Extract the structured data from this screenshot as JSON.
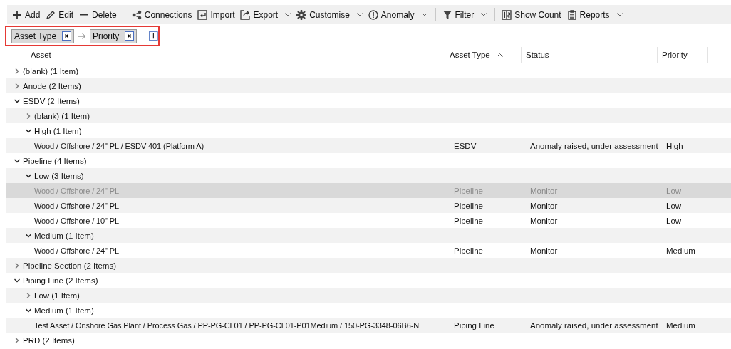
{
  "toolbar": {
    "groups": [
      [
        {
          "label": "Add",
          "has_menu": false
        },
        {
          "label": "Edit",
          "has_menu": false
        },
        {
          "label": "Delete",
          "has_menu": false
        }
      ],
      [
        {
          "label": "Connections",
          "has_menu": false
        },
        {
          "label": "Import",
          "has_menu": false
        },
        {
          "label": "Export",
          "has_menu": true
        },
        {
          "label": "Customise",
          "has_menu": true
        },
        {
          "label": "Anomaly",
          "has_menu": true
        }
      ],
      [
        {
          "label": "Filter",
          "has_menu": true
        }
      ],
      [
        {
          "label": "Show Count",
          "has_menu": false
        },
        {
          "label": "Reports",
          "has_menu": true
        }
      ]
    ]
  },
  "group_by": {
    "chips": [
      {
        "label": "Asset Type"
      },
      {
        "label": "Priority"
      }
    ]
  },
  "table": {
    "columns": [
      {
        "label": "Asset"
      },
      {
        "label": "Asset Type",
        "sorted_ascending": true
      },
      {
        "label": "Status"
      },
      {
        "label": "Priority"
      }
    ],
    "rows": [
      {
        "kind": "group",
        "label": "(blank) (1 Item)",
        "expanded": false
      },
      {
        "kind": "group",
        "label": "Anode (2 Items)",
        "expanded": false
      },
      {
        "kind": "group",
        "label": "ESDV (2 Items)",
        "expanded": true,
        "children": [
          {
            "kind": "group",
            "label": "(blank) (1 Item)",
            "expanded": false
          },
          {
            "kind": "group",
            "label": "High (1 Item)",
            "expanded": true,
            "children": [
              {
                "kind": "item",
                "cells": [
                  "Wood / Offshore / 24\" PL / ESDV 401 (Platform A)",
                  "ESDV",
                  "Anomaly raised, under assessment",
                  "High"
                ],
                "selected": false
              }
            ]
          }
        ]
      },
      {
        "kind": "group",
        "label": "Pipeline (4 Items)",
        "expanded": true,
        "children": [
          {
            "kind": "group",
            "label": "Low (3 Items)",
            "expanded": true,
            "children": [
              {
                "kind": "item",
                "cells": [
                  "Wood / Offshore / 24\" PL",
                  "Pipeline",
                  "Monitor",
                  "Low"
                ],
                "selected": true
              },
              {
                "kind": "item",
                "cells": [
                  "Wood / Offshore / 24\" PL",
                  "Pipeline",
                  "Monitor",
                  "Low"
                ],
                "selected": false
              },
              {
                "kind": "item",
                "cells": [
                  "Wood / Offshore / 10\" PL",
                  "Pipeline",
                  "Monitor",
                  "Low"
                ],
                "selected": false
              }
            ]
          },
          {
            "kind": "group",
            "label": "Medium (1 Item)",
            "expanded": true,
            "children": [
              {
                "kind": "item",
                "cells": [
                  "Wood / Offshore / 24\" PL",
                  "Pipeline",
                  "Monitor",
                  "Medium"
                ],
                "selected": false
              }
            ]
          }
        ]
      },
      {
        "kind": "group",
        "label": "Pipeline Section (2 Items)",
        "expanded": false
      },
      {
        "kind": "group",
        "label": "Piping Line (2 Items)",
        "expanded": true,
        "children": [
          {
            "kind": "group",
            "label": "Low (1 Item)",
            "expanded": false
          },
          {
            "kind": "group",
            "label": "Medium (1 Item)",
            "expanded": true,
            "children": [
              {
                "kind": "item",
                "cells": [
                  "Test Asset / Onshore Gas Plant / Process Gas / PP-PG-CL01 / PP-PG-CL01-P01Medium / 150-PG-3348-06B6-N",
                  "Piping Line",
                  "Anomaly raised, under assessment",
                  "Medium"
                ],
                "selected": false
              }
            ]
          }
        ]
      },
      {
        "kind": "group",
        "label": "PRD (2 Items)",
        "expanded": false
      }
    ]
  }
}
